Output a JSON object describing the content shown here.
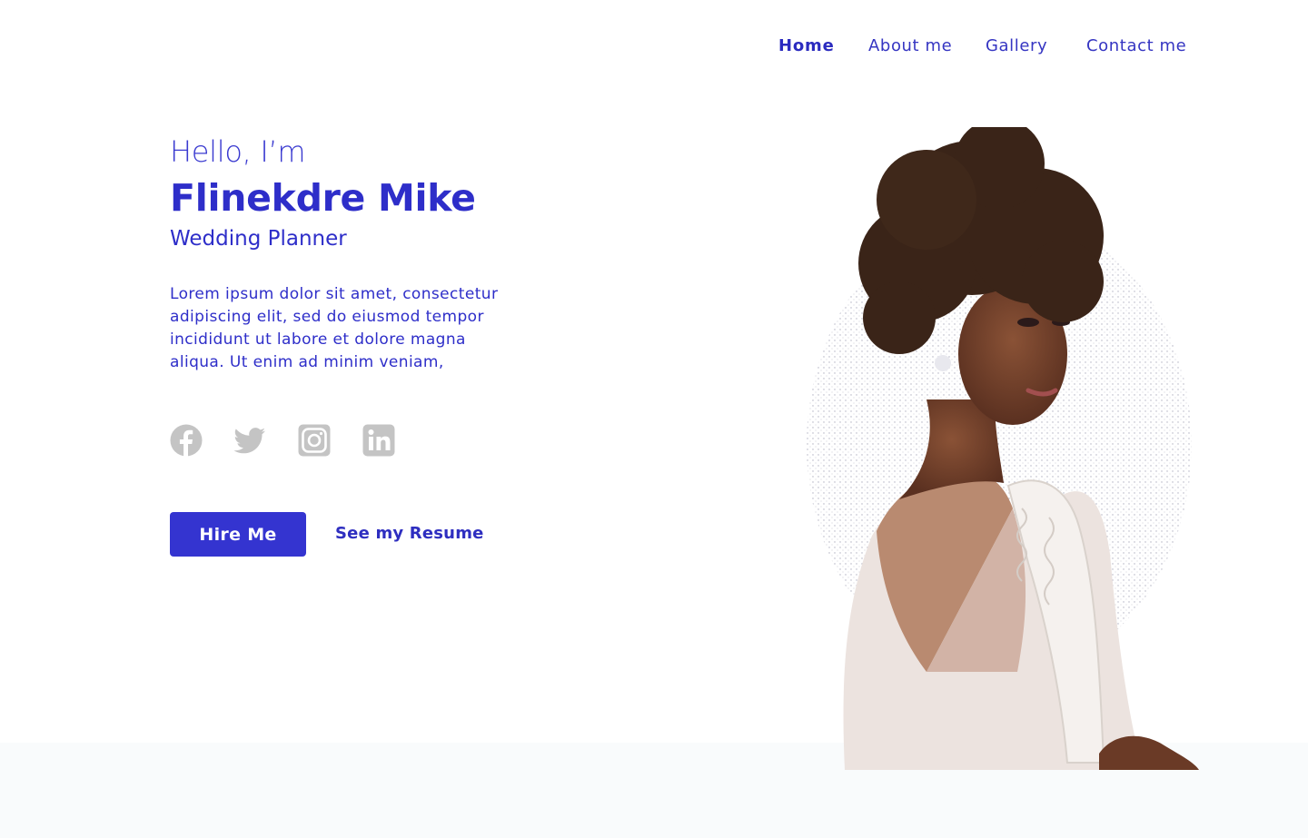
{
  "nav": {
    "items": [
      {
        "label": "Home",
        "active": true
      },
      {
        "label": "About me",
        "active": false
      },
      {
        "label": "Gallery",
        "active": false
      },
      {
        "label": "Contact me",
        "active": false
      }
    ]
  },
  "hero": {
    "greeting": "Hello, I’m",
    "name": "Flinekdre Mike",
    "role": "Wedding Planner",
    "bio": "Lorem ipsum dolor sit amet, consectetur adipiscing elit, sed do eiusmod tempor incididunt ut labore et dolore magna aliqua. Ut enim ad minim veniam,"
  },
  "socials": [
    {
      "icon": "facebook-icon"
    },
    {
      "icon": "twitter-icon"
    },
    {
      "icon": "instagram-icon"
    },
    {
      "icon": "linkedin-icon"
    }
  ],
  "actions": {
    "hire_label": "Hire Me",
    "resume_label": "See my Resume"
  },
  "colors": {
    "accent": "#3434d0",
    "text": "#2e2ec9",
    "icon_gray": "#c4c4c4",
    "footer_band": "#f9fbfc"
  }
}
